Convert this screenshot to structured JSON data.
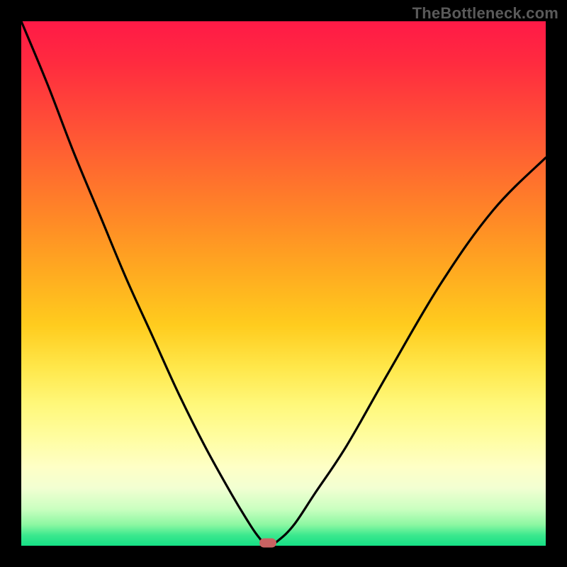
{
  "watermark": "TheBottleneck.com",
  "colors": {
    "frame": "#000000",
    "curve": "#000000",
    "marker": "#c96262"
  },
  "chart_data": {
    "type": "line",
    "title": "",
    "xlabel": "",
    "ylabel": "",
    "xlim": [
      0,
      100
    ],
    "ylim": [
      0,
      100
    ],
    "grid": false,
    "legend": false,
    "curve_note": "V-shaped bottleneck curve; minimum near x≈47 at y≈0",
    "x": [
      0,
      5,
      10,
      15,
      20,
      25,
      30,
      35,
      40,
      43,
      45,
      47,
      49,
      52,
      56,
      62,
      70,
      80,
      90,
      100
    ],
    "y": [
      100,
      88,
      75,
      63,
      51,
      40,
      29,
      19,
      10,
      5,
      2,
      0,
      1,
      4,
      10,
      19,
      33,
      50,
      64,
      74
    ],
    "marker": {
      "x": 47,
      "y": 0
    },
    "background_gradient": {
      "orientation": "vertical",
      "stops": [
        {
          "pos": 0.0,
          "color": "#ff1a47"
        },
        {
          "pos": 0.5,
          "color": "#ffcc1e"
        },
        {
          "pos": 0.8,
          "color": "#fffd9e"
        },
        {
          "pos": 1.0,
          "color": "#15df85"
        }
      ]
    }
  }
}
